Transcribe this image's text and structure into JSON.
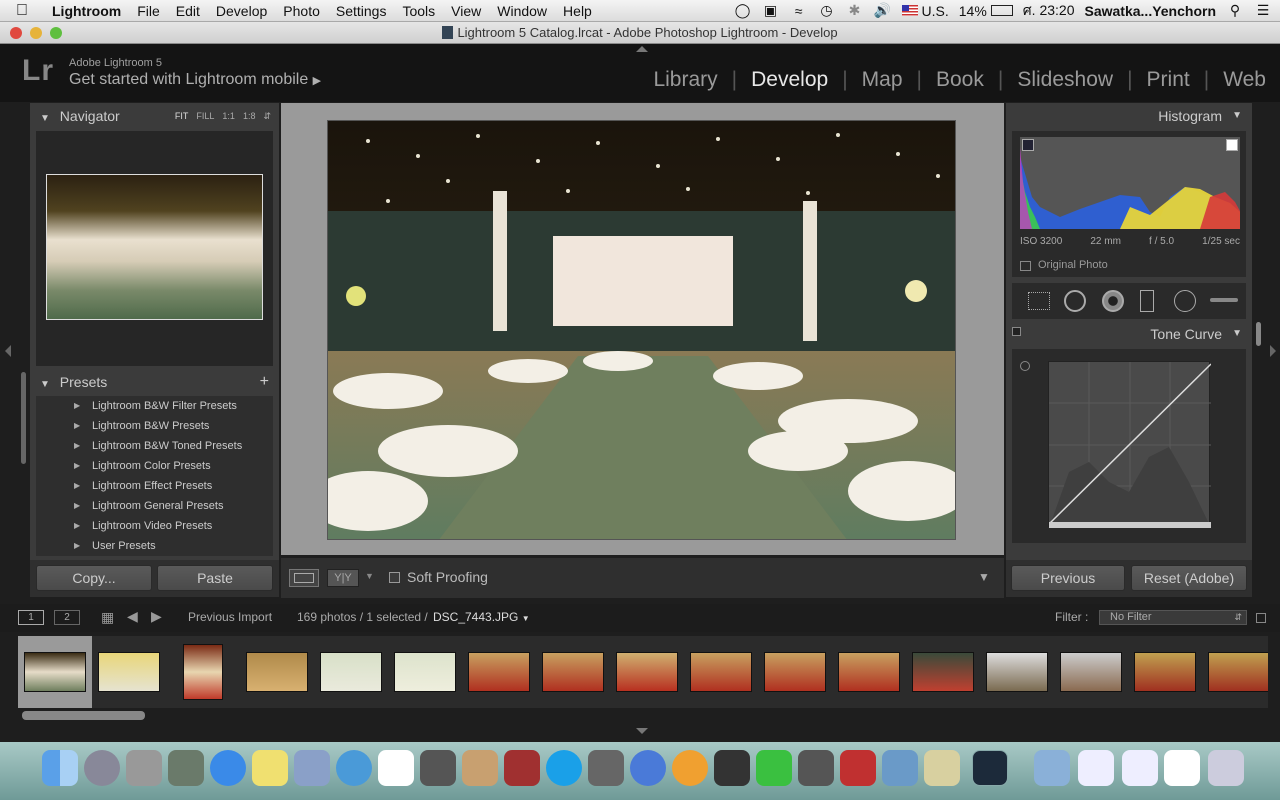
{
  "menubar": {
    "app": "Lightroom",
    "items": [
      "File",
      "Edit",
      "Develop",
      "Photo",
      "Settings",
      "Tools",
      "View",
      "Window",
      "Help"
    ],
    "input_source": "U.S.",
    "battery": "14%",
    "clock": "ศ. 23:20",
    "user": "Sawatka...Yenchorn"
  },
  "window": {
    "title": "Lightroom 5 Catalog.lrcat - Adobe Photoshop Lightroom - Develop"
  },
  "identity": {
    "logo": "Lr",
    "product": "Adobe Lightroom 5",
    "mobile": "Get started with Lightroom mobile"
  },
  "modules": [
    "Library",
    "Develop",
    "Map",
    "Book",
    "Slideshow",
    "Print",
    "Web"
  ],
  "active_module": "Develop",
  "navigator": {
    "title": "Navigator",
    "zoom": [
      "FIT",
      "FILL",
      "1:1",
      "1:8"
    ]
  },
  "presets": {
    "title": "Presets",
    "add": "+",
    "items": [
      "Lightroom B&W Filter Presets",
      "Lightroom B&W Presets",
      "Lightroom B&W Toned Presets",
      "Lightroom Color Presets",
      "Lightroom Effect Presets",
      "Lightroom General Presets",
      "Lightroom Video Presets",
      "User Presets"
    ]
  },
  "left_buttons": {
    "copy": "Copy...",
    "paste": "Paste"
  },
  "toolbar": {
    "soft_proofing": "Soft Proofing",
    "view_label": "Y|Y"
  },
  "histogram": {
    "title": "Histogram",
    "iso": "ISO 3200",
    "focal": "22 mm",
    "aperture": "f / 5.0",
    "shutter": "1/25 sec",
    "original": "Original Photo"
  },
  "tone_curve": {
    "title": "Tone Curve"
  },
  "right_buttons": {
    "previous": "Previous",
    "reset": "Reset (Adobe)"
  },
  "filmbar": {
    "page1": "1",
    "page2": "2",
    "source": "Previous Import",
    "count": "169 photos / 1 selected /",
    "file": "DSC_7443.JPG",
    "filter_label": "Filter :",
    "filter_value": "No Filter"
  },
  "thumbnail_count": 17
}
